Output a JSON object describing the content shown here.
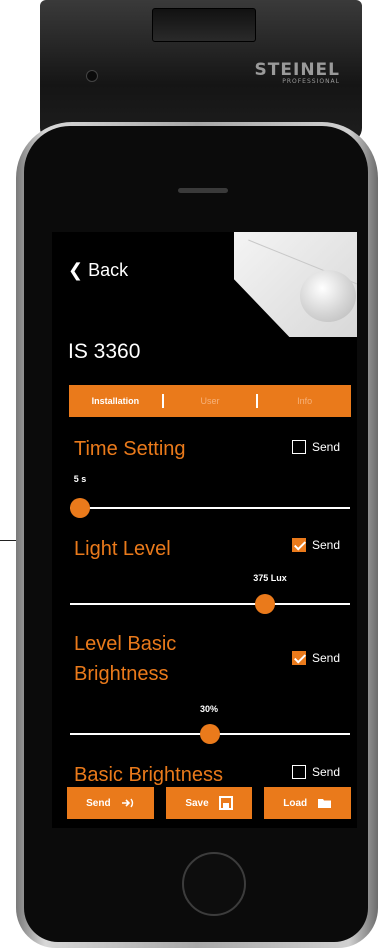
{
  "brand": {
    "name": "STEINEL",
    "sub": "PROFESSIONAL"
  },
  "nav": {
    "back_label": "Back",
    "title": "IS 3360"
  },
  "tabs": [
    {
      "label": "Installation",
      "active": true
    },
    {
      "label": "User",
      "active": false
    },
    {
      "label": "Info",
      "active": false
    }
  ],
  "sections": {
    "time_setting": {
      "title": "Time Setting",
      "send_label": "Send",
      "send_checked": false,
      "value_text": "5 s",
      "slider_fraction": 0.0
    },
    "light_level": {
      "title": "Light Level",
      "send_label": "Send",
      "send_checked": true,
      "value_text": "375 Lux",
      "slider_fraction": 0.71
    },
    "level_basic_brightness": {
      "title_line1": "Level Basic",
      "title_line2": "Brightness",
      "send_label": "Send",
      "send_checked": true,
      "value_text": "30%",
      "slider_fraction": 0.5
    },
    "basic_brightness": {
      "title": "Basic Brightness",
      "send_label": "Send",
      "send_checked": false
    }
  },
  "actions": {
    "send_label": "Send",
    "save_label": "Save",
    "load_label": "Load"
  },
  "colors": {
    "accent": "#ea7a1b",
    "screen_bg": "#000000"
  }
}
